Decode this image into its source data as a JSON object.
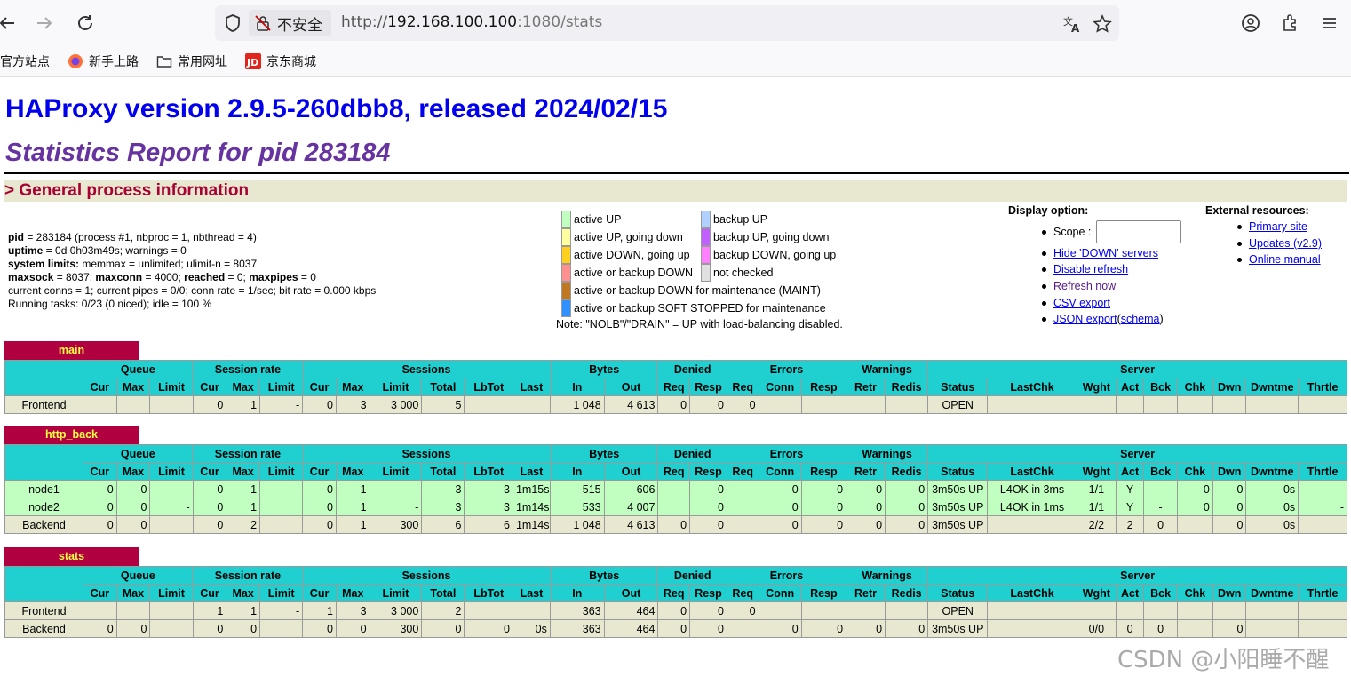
{
  "browser": {
    "insecure_label": "不安全",
    "url_scheme": "http://",
    "url_host": "192.168.100.100",
    "url_rest": ":1080/stats",
    "bookmarks": [
      "官方站点",
      "新手上路",
      "常用网址",
      "京东商城"
    ]
  },
  "page": {
    "title": "HAProxy version 2.9.5-260dbb8, released 2024/02/15",
    "subtitle": "Statistics Report for pid 283184",
    "section_general": "> General process information",
    "process": {
      "line1_pid_label": "pid",
      "line1": " = 283184 (process #1, nbproc = 1, nbthread = 4)",
      "line2_label": "uptime",
      "line2": " = 0d 0h03m49s; warnings = 0",
      "line3_label": "system limits:",
      "line3": " memmax = unlimited; ulimit-n = 8037",
      "line4_a_label": "maxsock",
      "line4_a": " = 8037; ",
      "line4_b_label": "maxconn",
      "line4_b": " = 4000; ",
      "line4_c_label": "reached",
      "line4_c": " = 0; ",
      "line4_d_label": "maxpipes",
      "line4_d": " = 0",
      "line5": "current conns = 1; current pipes = 0/0; conn rate = 1/sec; bit rate = 0.000 kbps",
      "line6": "Running tasks: 0/23 (0 niced); idle = 100 %"
    },
    "legend": [
      {
        "label": "active UP",
        "color": "#c0ffc0"
      },
      {
        "label": "active UP, going down",
        "color": "#ffffa0"
      },
      {
        "label": "active DOWN, going up",
        "color": "#ffd020"
      },
      {
        "label": "active or backup DOWN",
        "color": "#ff9090"
      },
      {
        "label": "active or backup DOWN for maintenance (MAINT)",
        "color": "#c07820"
      },
      {
        "label": "active or backup SOFT STOPPED for maintenance",
        "color": "#3090ff"
      },
      {
        "label": "backup UP",
        "color": "#b0d0ff"
      },
      {
        "label": "backup UP, going down",
        "color": "#c060ff"
      },
      {
        "label": "backup DOWN, going up",
        "color": "#ff80ff"
      },
      {
        "label": "not checked",
        "color": "#e0e0e0"
      }
    ],
    "legend_note": "Note: \"NOLB\"/\"DRAIN\" = UP with load-balancing disabled.",
    "display_option": {
      "heading": "Display option:",
      "scope_label": "Scope :",
      "links": [
        "Hide 'DOWN' servers",
        "Disable refresh",
        "Refresh now",
        "CSV export",
        "JSON export"
      ],
      "json_paren_open": " (",
      "schema_link": "schema",
      "json_paren_close": ")"
    },
    "external": {
      "heading": "External resources:",
      "links": [
        "Primary site",
        "Updates (v2.9)",
        "Online manual"
      ]
    }
  },
  "table_headers": {
    "groups": [
      "Queue",
      "Session rate",
      "Sessions",
      "Bytes",
      "Denied",
      "Errors",
      "Warnings",
      "Server"
    ],
    "cols": [
      "Cur",
      "Max",
      "Limit",
      "Cur",
      "Max",
      "Limit",
      "Cur",
      "Max",
      "Limit",
      "Total",
      "LbTot",
      "Last",
      "In",
      "Out",
      "Req",
      "Resp",
      "Req",
      "Conn",
      "Resp",
      "Retr",
      "Redis",
      "Status",
      "LastChk",
      "Wght",
      "Act",
      "Bck",
      "Chk",
      "Dwn",
      "Dwntme",
      "Thrtle"
    ]
  },
  "proxies": [
    {
      "name": "main",
      "rows": [
        {
          "type": "front",
          "cells": [
            "Frontend",
            "",
            "",
            "",
            "0",
            "1",
            "-",
            "0",
            "3",
            "3 000",
            "5",
            "",
            "",
            "1 048",
            "4 613",
            "0",
            "0",
            "0",
            "",
            "",
            "",
            "",
            "OPEN",
            "",
            "",
            "",
            "",
            "",
            "",
            "",
            ""
          ]
        }
      ]
    },
    {
      "name": "http_back",
      "rows": [
        {
          "type": "up",
          "cells": [
            "node1",
            "0",
            "0",
            "-",
            "0",
            "1",
            "",
            "0",
            "1",
            "-",
            "3",
            "3",
            "1m15s",
            "515",
            "606",
            "",
            "0",
            "",
            "0",
            "0",
            "0",
            "0",
            "3m50s UP",
            "L4OK in 3ms",
            "1/1",
            "Y",
            "-",
            "0",
            "0",
            "0s",
            "-"
          ]
        },
        {
          "type": "up",
          "cells": [
            "node2",
            "0",
            "0",
            "-",
            "0",
            "1",
            "",
            "0",
            "1",
            "-",
            "3",
            "3",
            "1m14s",
            "533",
            "4 007",
            "",
            "0",
            "",
            "0",
            "0",
            "0",
            "0",
            "3m50s UP",
            "L4OK in 1ms",
            "1/1",
            "Y",
            "-",
            "0",
            "0",
            "0s",
            "-"
          ]
        },
        {
          "type": "back",
          "cells": [
            "Backend",
            "0",
            "0",
            "",
            "0",
            "2",
            "",
            "0",
            "1",
            "300",
            "6",
            "6",
            "1m14s",
            "1 048",
            "4 613",
            "0",
            "0",
            "",
            "0",
            "0",
            "0",
            "0",
            "3m50s UP",
            "",
            "2/2",
            "2",
            "0",
            "",
            "0",
            "0s",
            ""
          ]
        }
      ]
    },
    {
      "name": "stats",
      "rows": [
        {
          "type": "front",
          "cells": [
            "Frontend",
            "",
            "",
            "",
            "1",
            "1",
            "-",
            "1",
            "3",
            "3 000",
            "2",
            "",
            "",
            "363",
            "464",
            "0",
            "0",
            "0",
            "",
            "",
            "",
            "",
            "OPEN",
            "",
            "",
            "",
            "",
            "",
            "",
            "",
            ""
          ]
        },
        {
          "type": "back",
          "cells": [
            "Backend",
            "0",
            "0",
            "",
            "0",
            "0",
            "",
            "0",
            "0",
            "300",
            "0",
            "0",
            "0s",
            "363",
            "464",
            "0",
            "0",
            "",
            "0",
            "0",
            "0",
            "0",
            "3m50s UP",
            "",
            "0/0",
            "0",
            "0",
            "",
            "0",
            "",
            ""
          ]
        }
      ]
    }
  ],
  "watermark": "CSDN @小阳睡不醒"
}
